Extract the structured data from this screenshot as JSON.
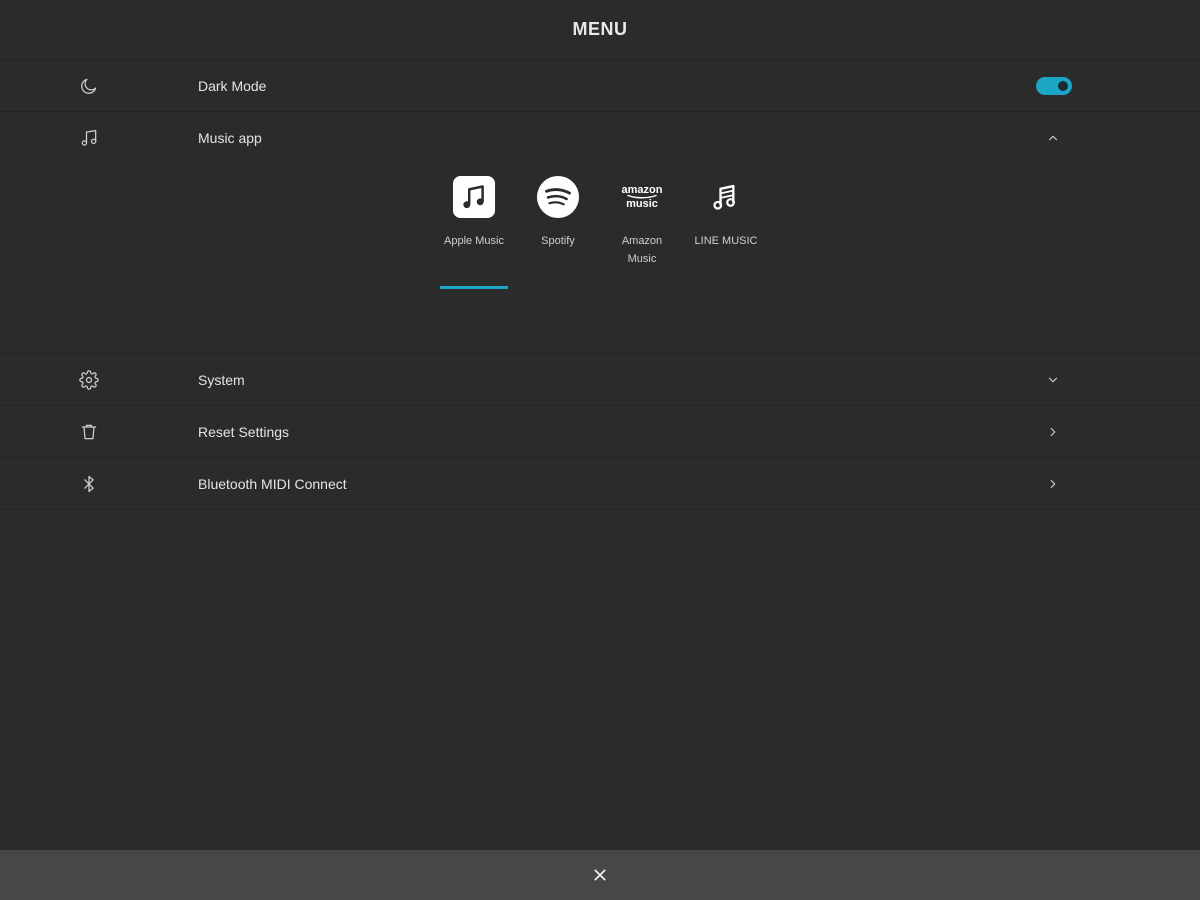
{
  "header": {
    "title": "MENU"
  },
  "dark_mode": {
    "label": "Dark Mode",
    "icon": "moon-icon",
    "enabled": true,
    "accent": "#1aa6c4"
  },
  "music_app": {
    "label": "Music app",
    "icon": "music-note-icon",
    "expanded": true,
    "apps": [
      {
        "name": "Apple Music",
        "icon": "apple-music-icon",
        "selected": true
      },
      {
        "name": "Spotify",
        "icon": "spotify-icon",
        "selected": false
      },
      {
        "name": "Amazon Music",
        "icon": "amazon-music-icon",
        "selected": false,
        "logo_top": "amazon",
        "logo_bottom": "music"
      },
      {
        "name": "LINE MUSIC",
        "icon": "line-music-icon",
        "selected": false
      }
    ]
  },
  "system": {
    "label": "System",
    "icon": "gear-icon"
  },
  "reset": {
    "label": "Reset Settings",
    "icon": "trash-icon"
  },
  "bluetooth": {
    "label": "Bluetooth MIDI Connect",
    "icon": "bluetooth-icon"
  },
  "footer": {
    "close_icon": "close-icon"
  },
  "colors": {
    "background": "#2b2b2b",
    "footer": "#474747",
    "accent": "#1aa6c4"
  }
}
